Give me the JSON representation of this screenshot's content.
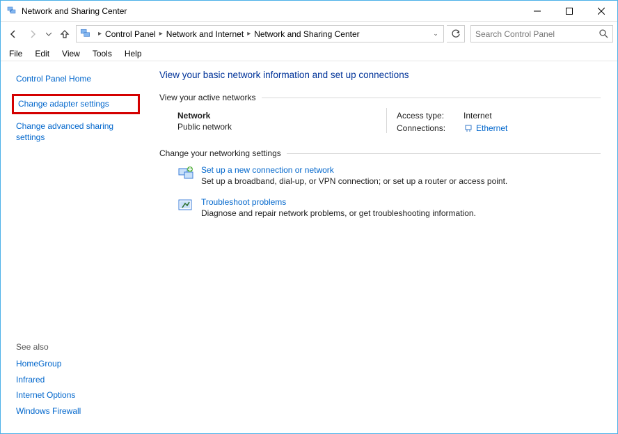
{
  "window": {
    "title": "Network and Sharing Center"
  },
  "breadcrumb": {
    "items": [
      "Control Panel",
      "Network and Internet",
      "Network and Sharing Center"
    ]
  },
  "search": {
    "placeholder": "Search Control Panel"
  },
  "menu": {
    "items": [
      "File",
      "Edit",
      "View",
      "Tools",
      "Help"
    ]
  },
  "sidebar": {
    "home": "Control Panel Home",
    "adapter": "Change adapter settings",
    "advanced": "Change advanced sharing settings",
    "seeAlsoLabel": "See also",
    "seeAlso": [
      "HomeGroup",
      "Infrared",
      "Internet Options",
      "Windows Firewall"
    ]
  },
  "main": {
    "title": "View your basic network information and set up connections",
    "activeNetworksLabel": "View your active networks",
    "network": {
      "name": "Network",
      "type": "Public network",
      "accessTypeLabel": "Access type:",
      "accessTypeValue": "Internet",
      "connectionsLabel": "Connections:",
      "connectionsValue": "Ethernet"
    },
    "changeSettingsLabel": "Change your networking settings",
    "setup": {
      "title": "Set up a new connection or network",
      "desc": "Set up a broadband, dial-up, or VPN connection; or set up a router or access point."
    },
    "troubleshoot": {
      "title": "Troubleshoot problems",
      "desc": "Diagnose and repair network problems, or get troubleshooting information."
    }
  }
}
